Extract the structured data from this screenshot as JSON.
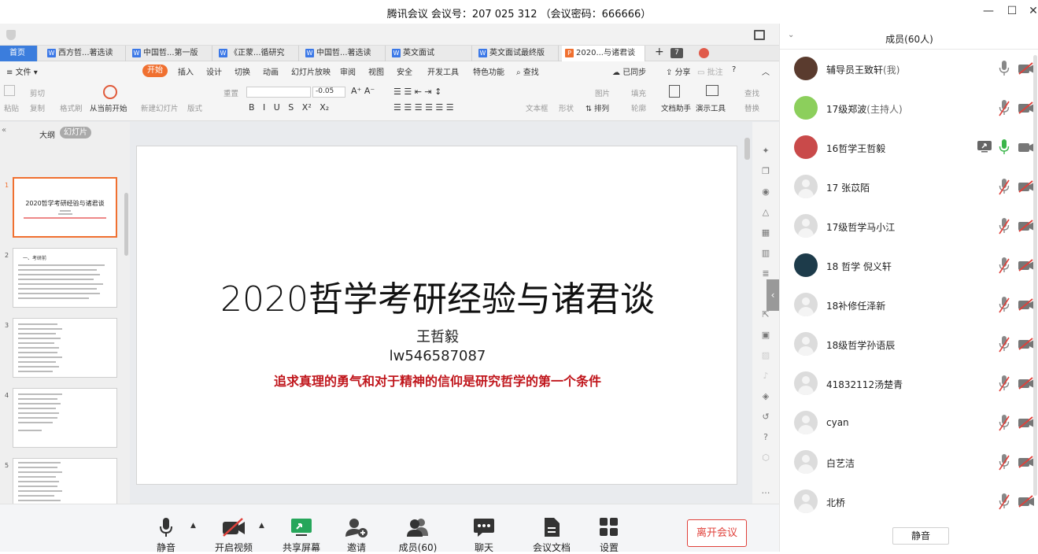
{
  "window": {
    "title": "腾讯会议 会议号：207 025 312  （会议密码：666666）"
  },
  "wps": {
    "tabs": [
      {
        "label": "首页"
      },
      {
        "label": "西方哲...著选读"
      },
      {
        "label": "中国哲...第一版"
      },
      {
        "label": "《正蒙...循研究"
      },
      {
        "label": "中国哲...著选读"
      },
      {
        "label": "英文面试"
      },
      {
        "label": "英文面试最终版"
      },
      {
        "label": "2020...与诸君谈"
      }
    ],
    "tab_count": "7",
    "menu": {
      "file": "文件",
      "start": "开始",
      "items": [
        "插入",
        "设计",
        "切换",
        "动画",
        "幻灯片放映",
        "审阅",
        "视图",
        "安全",
        "开发工具",
        "特色功能",
        "查找"
      ],
      "sync": "已同步",
      "share": "分享",
      "comment": "批注"
    },
    "ribbon": {
      "paste": "粘贴",
      "cut": "剪切",
      "copy": "复制",
      "format_painter": "格式刷",
      "play_from_current": "从当前开始",
      "new_slide": "新建幻灯片",
      "layout": "版式",
      "reset": "重置",
      "font_spacing": "-0.05",
      "textbox": "文本框",
      "shape": "形状",
      "arrange": "排列",
      "picture": "图片",
      "fill": "填充",
      "outline": "轮廓",
      "doc_helper": "文档助手",
      "present_tools": "演示工具",
      "find": "查找",
      "replace": "替换"
    },
    "panel_tabs": {
      "outline": "大纲",
      "slides": "幻灯片"
    },
    "thumbnails": [
      {
        "num": "1",
        "title": "2020哲学考研经验与诸君谈"
      },
      {
        "num": "2",
        "heading": "一、考研前"
      },
      {
        "num": "3"
      },
      {
        "num": "4"
      },
      {
        "num": "5"
      }
    ],
    "slide": {
      "title": "2020哲学考研经验与诸君谈",
      "name": "王哲毅",
      "id": "lw546587087",
      "quote": "追求真理的勇气和对于精神的信仰是研究哲学的第一个条件"
    }
  },
  "toolbar": {
    "mute": "静音",
    "video": "开启视频",
    "share_screen": "共享屏幕",
    "invite": "邀请",
    "members": "成员(60)",
    "chat": "聊天",
    "docs": "会议文档",
    "settings": "设置",
    "leave": "离开会议"
  },
  "members_panel": {
    "title": "成员(60人)",
    "mute_all": "静音",
    "members": [
      {
        "name": "辅导员王致轩",
        "role": "(我)",
        "mic": "on",
        "cam": "off"
      },
      {
        "name": "17级郑波",
        "role": "(主持人)",
        "mic": "off",
        "cam": "off"
      },
      {
        "name": "16哲学王哲毅",
        "role": "",
        "mic": "active",
        "cam": "on",
        "sharing": true
      },
      {
        "name": "17 张苡陌",
        "role": "",
        "mic": "off",
        "cam": "off"
      },
      {
        "name": "17级哲学马小江",
        "role": "",
        "mic": "off",
        "cam": "off"
      },
      {
        "name": "18 哲学 倪义轩",
        "role": "",
        "mic": "off",
        "cam": "off"
      },
      {
        "name": "18补修任泽新",
        "role": "",
        "mic": "off",
        "cam": "off"
      },
      {
        "name": "18级哲学孙语辰",
        "role": "",
        "mic": "off",
        "cam": "off"
      },
      {
        "name": "41832112汤楚青",
        "role": "",
        "mic": "off",
        "cam": "off"
      },
      {
        "name": "cyan",
        "role": "",
        "mic": "off",
        "cam": "off"
      },
      {
        "name": "白艺洁",
        "role": "",
        "mic": "off",
        "cam": "off"
      },
      {
        "name": "北桥",
        "role": "",
        "mic": "off",
        "cam": "off"
      }
    ]
  }
}
